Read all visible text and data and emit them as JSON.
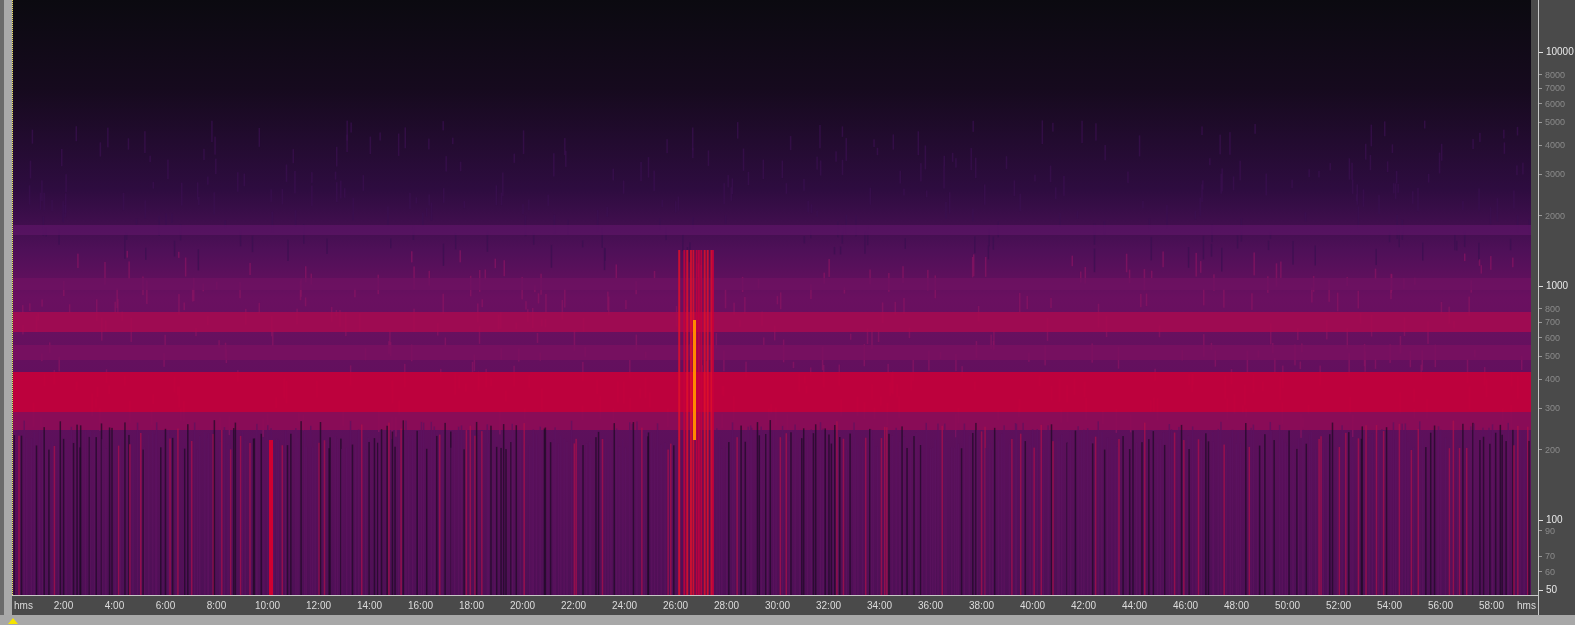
{
  "spectrogram": {
    "frequency_axis": {
      "ticks": [
        {
          "label": "10000",
          "major": true
        },
        {
          "label": "8000",
          "major": false
        },
        {
          "label": "7000",
          "major": false
        },
        {
          "label": "6000",
          "major": false
        },
        {
          "label": "5000",
          "major": false
        },
        {
          "label": "4000",
          "major": false
        },
        {
          "label": "3000",
          "major": false
        },
        {
          "label": "2000",
          "major": false
        },
        {
          "label": "1000",
          "major": true
        },
        {
          "label": "800",
          "major": false
        },
        {
          "label": "700",
          "major": false
        },
        {
          "label": "600",
          "major": false
        },
        {
          "label": "500",
          "major": false
        },
        {
          "label": "400",
          "major": false
        },
        {
          "label": "300",
          "major": false
        },
        {
          "label": "200",
          "major": false
        },
        {
          "label": "100",
          "major": true
        },
        {
          "label": "90",
          "major": false
        },
        {
          "label": "70",
          "major": false
        },
        {
          "label": "60",
          "major": false
        },
        {
          "label": "50",
          "major": true
        }
      ]
    },
    "time_axis": {
      "start_unit": "hms",
      "end_unit": "hms",
      "ticks": [
        "2:00",
        "4:00",
        "6:00",
        "8:00",
        "10:00",
        "12:00",
        "14:00",
        "16:00",
        "18:00",
        "20:00",
        "22:00",
        "24:00",
        "26:00",
        "28:00",
        "30:00",
        "32:00",
        "34:00",
        "36:00",
        "38:00",
        "40:00",
        "42:00",
        "44:00",
        "46:00",
        "48:00",
        "50:00",
        "52:00",
        "54:00",
        "56:00",
        "58:00"
      ]
    }
  }
}
